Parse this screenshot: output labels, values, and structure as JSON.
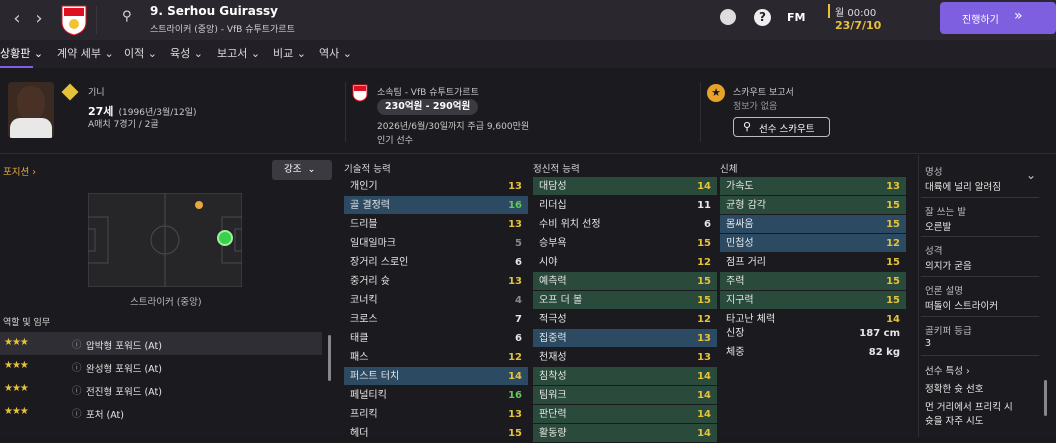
{
  "topbar": {
    "player_title": "9. Serhou Guirassy",
    "player_subtitle": "스트라이커 (중앙) - VfB 슈투트가르트",
    "fm_label": "FM",
    "time": "월 00:00",
    "date": "23/7/10",
    "continue_label": "진행하기"
  },
  "tabs": [
    "상황판",
    "계약 세부",
    "이적",
    "육성",
    "보고서",
    "비교",
    "역사"
  ],
  "header": {
    "nation": "기니",
    "age_value": "27세",
    "age_birth": "(1996년/3월/12일)",
    "caps": "A매치 7경기 / 2골",
    "club_line": "소속팀 - VfB 슈투트가르트",
    "value": "230억원 - 290억원",
    "contract": "2026년/6월/30일까지 주급 9,600만원",
    "status": "인기 선수",
    "scout_title": "스카우트 보고서",
    "scout_sub": "정보가 없음",
    "scout_button": "선수 스카우트"
  },
  "left": {
    "position_label": "포지션",
    "emphasis_label": "강조",
    "pitch_caption": "스트라이커 (중앙)",
    "roles_title": "역할 및 임무",
    "roles": [
      {
        "stars": "★★★",
        "name": "압박형 포워드 (At)"
      },
      {
        "stars": "★★★",
        "name": "완성형 포워드 (At)"
      },
      {
        "stars": "★★★",
        "name": "전진형 포워드 (At)"
      },
      {
        "stars": "★★★",
        "name": "포처 (At)"
      }
    ]
  },
  "attributes": {
    "technical_title": "기술적 능력",
    "mental_title": "정신적 능력",
    "physical_title": "신체",
    "technical": [
      {
        "name": "개인기",
        "value": "13",
        "tone": "y",
        "hl": ""
      },
      {
        "name": "골 결정력",
        "value": "16",
        "tone": "g",
        "hl": "blue"
      },
      {
        "name": "드리블",
        "value": "13",
        "tone": "y",
        "hl": ""
      },
      {
        "name": "일대일마크",
        "value": "5",
        "tone": "gray",
        "hl": ""
      },
      {
        "name": "장거리 스로인",
        "value": "6",
        "tone": "w",
        "hl": ""
      },
      {
        "name": "중거리 슛",
        "value": "13",
        "tone": "y",
        "hl": ""
      },
      {
        "name": "코너킥",
        "value": "4",
        "tone": "gray",
        "hl": ""
      },
      {
        "name": "크로스",
        "value": "7",
        "tone": "w",
        "hl": ""
      },
      {
        "name": "태클",
        "value": "6",
        "tone": "w",
        "hl": ""
      },
      {
        "name": "패스",
        "value": "12",
        "tone": "y",
        "hl": ""
      },
      {
        "name": "퍼스트 터치",
        "value": "14",
        "tone": "y",
        "hl": "blue"
      },
      {
        "name": "페널티킥",
        "value": "16",
        "tone": "g",
        "hl": ""
      },
      {
        "name": "프리킥",
        "value": "13",
        "tone": "y",
        "hl": ""
      },
      {
        "name": "헤더",
        "value": "15",
        "tone": "y",
        "hl": ""
      }
    ],
    "mental": [
      {
        "name": "대담성",
        "value": "14",
        "tone": "y",
        "hl": "green"
      },
      {
        "name": "리더십",
        "value": "11",
        "tone": "w",
        "hl": ""
      },
      {
        "name": "수비 위치 선정",
        "value": "6",
        "tone": "w",
        "hl": ""
      },
      {
        "name": "승부욕",
        "value": "15",
        "tone": "y",
        "hl": ""
      },
      {
        "name": "시야",
        "value": "12",
        "tone": "y",
        "hl": ""
      },
      {
        "name": "예측력",
        "value": "15",
        "tone": "y",
        "hl": "green"
      },
      {
        "name": "오프 더 볼",
        "value": "15",
        "tone": "y",
        "hl": "green"
      },
      {
        "name": "적극성",
        "value": "12",
        "tone": "y",
        "hl": ""
      },
      {
        "name": "집중력",
        "value": "13",
        "tone": "y",
        "hl": "blue"
      },
      {
        "name": "천재성",
        "value": "13",
        "tone": "y",
        "hl": ""
      },
      {
        "name": "침착성",
        "value": "14",
        "tone": "y",
        "hl": "green"
      },
      {
        "name": "팀워크",
        "value": "14",
        "tone": "y",
        "hl": "green"
      },
      {
        "name": "판단력",
        "value": "14",
        "tone": "y",
        "hl": "green"
      },
      {
        "name": "활동량",
        "value": "14",
        "tone": "y",
        "hl": "green"
      }
    ],
    "physical": [
      {
        "name": "가속도",
        "value": "13",
        "tone": "y",
        "hl": "green"
      },
      {
        "name": "균형 감각",
        "value": "15",
        "tone": "y",
        "hl": "green"
      },
      {
        "name": "몸싸움",
        "value": "15",
        "tone": "y",
        "hl": "blue"
      },
      {
        "name": "민첩성",
        "value": "12",
        "tone": "y",
        "hl": "blue"
      },
      {
        "name": "점프 거리",
        "value": "15",
        "tone": "y",
        "hl": ""
      },
      {
        "name": "주력",
        "value": "15",
        "tone": "y",
        "hl": "green"
      },
      {
        "name": "지구력",
        "value": "15",
        "tone": "y",
        "hl": "green"
      },
      {
        "name": "타고난 체력",
        "value": "14",
        "tone": "y",
        "hl": ""
      }
    ],
    "height_label": "신장",
    "height_value": "187 cm",
    "weight_label": "체중",
    "weight_value": "82 kg"
  },
  "right_panel": {
    "reputation_label": "명성",
    "reputation_value": "대륙에 널리 알려짐",
    "foot_label": "잘 쓰는 발",
    "foot_value": "오른발",
    "personality_label": "성격",
    "personality_value": "의지가 굳음",
    "media_label": "언론 설명",
    "media_value": "떠돌이 스트라이커",
    "gk_rating_label": "골키퍼 등급",
    "gk_rating_value": "3",
    "traits_label": "선수 특성",
    "traits": [
      "정확한 슛 선호",
      "먼 거리에서 프리킥 시",
      "슛을 자주 시도"
    ]
  },
  "colors": {
    "accent": "#7d5fe0",
    "yellow": "#e6c23a",
    "green": "#63c75c",
    "hl_blue": "#2c4b63",
    "hl_green": "#2a4a3c"
  }
}
